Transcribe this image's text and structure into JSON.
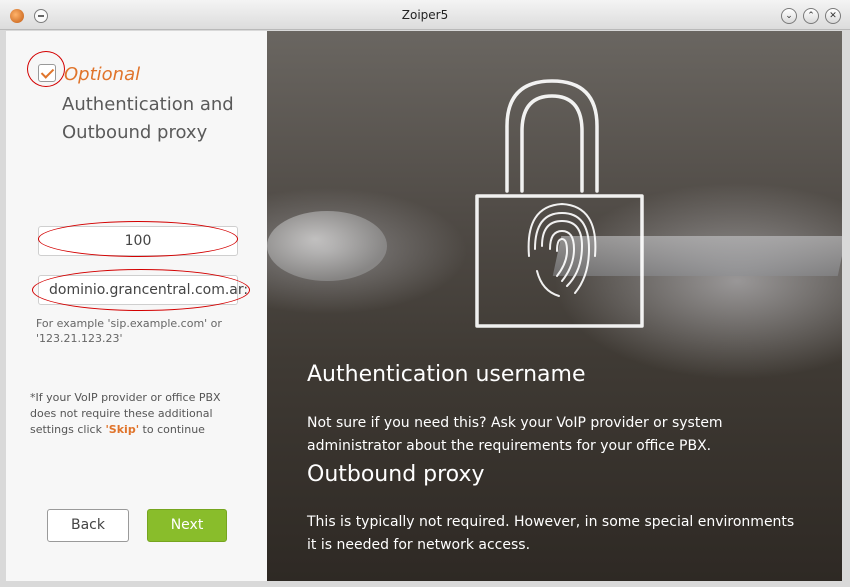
{
  "window": {
    "title": "Zoiper5"
  },
  "left": {
    "optional_label": "Optional",
    "heading_line1": "Authentication and",
    "heading_line2": "Outbound proxy",
    "username_value": "100",
    "proxy_value": "dominio.grancentral.com.ar:",
    "hint_line1": "For example 'sip.example.com' or",
    "hint_line2": "'123.21.123.23'",
    "note_prefix": "*If your VoIP provider or office PBX does not require these additional settings click ",
    "note_skip": "'Skip'",
    "note_suffix": " to continue",
    "back_label": "Back",
    "next_label": "Next"
  },
  "right": {
    "auth_title": "Authentication username",
    "auth_text": "Not sure if you need this? Ask your VoIP provider or system administrator about the requirements for your office PBX.",
    "proxy_title": "Outbound proxy",
    "proxy_text": "This is typically not required. However, in some special environments it is needed for network access."
  }
}
